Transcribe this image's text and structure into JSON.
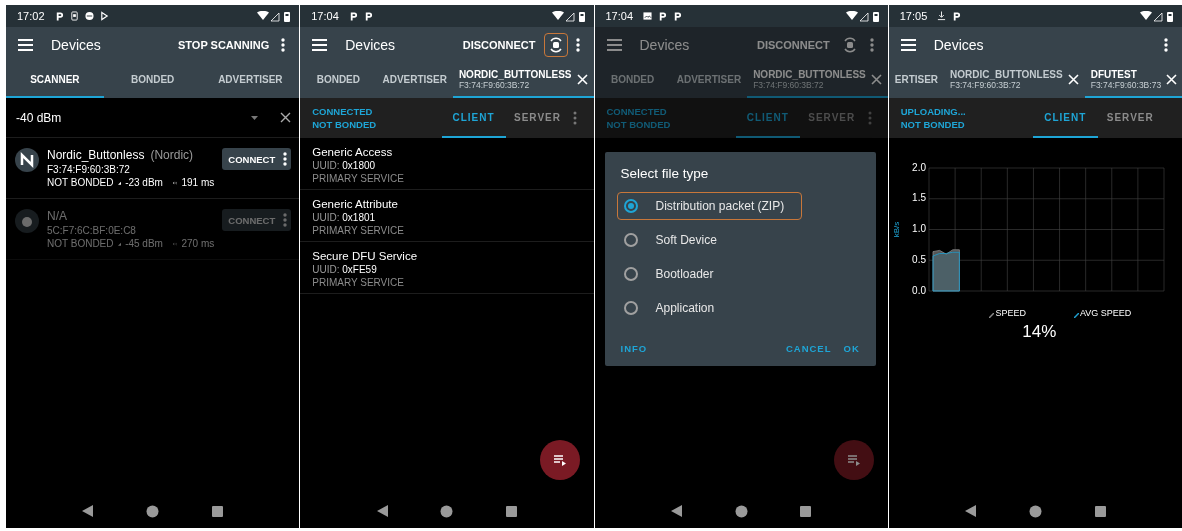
{
  "screens": [
    {
      "kind": "scanner",
      "status_bar": {
        "time": "17:02"
      },
      "app_bar": {
        "title": "Devices",
        "actions": [
          {
            "kind": "text",
            "label": "STOP SCANNING"
          },
          {
            "kind": "menu"
          }
        ]
      },
      "tabs": [
        {
          "label": "SCANNER",
          "selected": true
        },
        {
          "label": "BONDED",
          "selected": false
        },
        {
          "label": "ADVERTISER",
          "selected": false
        }
      ],
      "filter": {
        "value": "-40 dBm"
      },
      "devices": [
        {
          "name": "Nordic_Buttonless",
          "manufacturer": "(Nordic)",
          "address": "F3:74:F9:60:3B:72",
          "bond": "NOT BONDED",
          "rssi": "-23 dBm",
          "interval": "191 ms",
          "button": "CONNECT",
          "dimmed": false
        },
        {
          "name": "N/A",
          "address": "5C:F7:6C:BF:0E:C8",
          "bond": "NOT BONDED",
          "rssi": "-45 dBm",
          "interval": "270 ms",
          "button": "CONNECT",
          "dimmed": true
        }
      ]
    },
    {
      "kind": "services",
      "status_bar": {
        "time": "17:04"
      },
      "app_bar": {
        "title": "Devices",
        "actions": [
          {
            "kind": "text",
            "label": "DISCONNECT"
          },
          {
            "kind": "dfu",
            "highlighted": true
          },
          {
            "kind": "menu"
          }
        ]
      },
      "tabs": [
        {
          "label": "BONDED",
          "selected": false
        },
        {
          "label": "ADVERTISER",
          "selected": false
        },
        {
          "label": "NORDIC_BUTTONLESS",
          "sublabel": "F3:74:F9:60:3B:72",
          "closable": true,
          "selected": true
        }
      ],
      "connection": {
        "lines": [
          "CONNECTED",
          "NOT BONDED"
        ],
        "subtabs": [
          {
            "label": "CLIENT",
            "selected": true
          },
          {
            "label": "SERVER",
            "selected": false
          }
        ],
        "menu": true
      },
      "services": [
        {
          "name": "Generic Access",
          "uuid_label": "UUID:",
          "uuid": "0x1800",
          "type": "PRIMARY SERVICE"
        },
        {
          "name": "Generic Attribute",
          "uuid_label": "UUID:",
          "uuid": "0x1801",
          "type": "PRIMARY SERVICE"
        },
        {
          "name": "Secure DFU Service",
          "uuid_label": "UUID:",
          "uuid": "0xFE59",
          "type": "PRIMARY SERVICE"
        }
      ],
      "fab": true
    },
    {
      "kind": "dialog",
      "status_bar": {
        "time": "17:04"
      },
      "app_bar": {
        "title": "Devices",
        "actions": [
          {
            "kind": "text",
            "label": "DISCONNECT"
          },
          {
            "kind": "dfu",
            "highlighted": false
          },
          {
            "kind": "menu"
          }
        ]
      },
      "tabs": [
        {
          "label": "BONDED",
          "selected": false
        },
        {
          "label": "ADVERTISER",
          "selected": false
        },
        {
          "label": "NORDIC_BUTTONLESS",
          "sublabel": "F3:74:F9:60:3B:72",
          "closable": true,
          "selected": true
        }
      ],
      "connection": {
        "lines": [
          "CONNECTED",
          "NOT BONDED"
        ],
        "subtabs": [
          {
            "label": "CLIENT",
            "selected": true
          },
          {
            "label": "SERVER",
            "selected": false
          }
        ],
        "menu": true
      },
      "fab": true,
      "dialog": {
        "title": "Select file type",
        "options": [
          {
            "label": "Distribution packet (ZIP)",
            "selected": true,
            "highlighted": true
          },
          {
            "label": "Soft Device",
            "selected": false,
            "highlighted": false
          },
          {
            "label": "Bootloader",
            "selected": false,
            "highlighted": false
          },
          {
            "label": "Application",
            "selected": false,
            "highlighted": false
          }
        ],
        "buttons": [
          "INFO",
          "CANCEL",
          "OK"
        ]
      }
    },
    {
      "kind": "upload",
      "status_bar": {
        "time": "17:05"
      },
      "app_bar": {
        "title": "Devices",
        "actions": [
          {
            "kind": "menu"
          }
        ]
      },
      "tabs": [
        {
          "label": "ERTISER",
          "selected": false
        },
        {
          "label": "NORDIC_BUTTONLESS",
          "sublabel": "F3:74:F9:60:3B:72",
          "closable": true,
          "selected": false
        },
        {
          "label": "DFUTEST",
          "sublabel": "F3:74:F9:60:3B:73",
          "closable": true,
          "selected": true
        }
      ],
      "connection": {
        "lines": [
          "UPLOADING...",
          "NOT BONDED"
        ],
        "subtabs": [
          {
            "label": "CLIENT",
            "selected": true
          },
          {
            "label": "SERVER",
            "selected": false
          }
        ],
        "menu": false
      },
      "chart_data": {
        "type": "area",
        "ylabel": "kB/s",
        "grid": true,
        "categories": [
          null,
          null,
          null,
          null,
          null,
          null,
          null,
          null,
          null,
          null,
          null,
          null,
          null,
          null,
          null,
          null,
          null,
          null,
          null,
          null,
          null,
          null,
          null,
          null,
          null,
          null,
          null,
          null,
          null,
          null,
          null,
          null,
          null,
          null,
          null,
          null
        ],
        "ylim": [
          0,
          2
        ],
        "yticks": [
          {
            "value": 0,
            "label": "0.0"
          },
          {
            "value": 0.5,
            "label": "0.5"
          },
          {
            "value": 1,
            "label": "1.0"
          },
          {
            "value": 1.5,
            "label": "1.5"
          },
          {
            "value": 2,
            "label": "2.0"
          }
        ],
        "series": [
          {
            "name": "SPEED",
            "color": "#8a8a8a",
            "values": [
              0.64,
              0.66,
              0.6,
              0.67,
              0.67,
              null,
              null,
              null,
              null,
              null,
              null,
              null,
              null,
              null,
              null,
              null,
              null,
              null,
              null,
              null,
              null,
              null,
              null,
              null,
              null,
              null,
              null,
              null,
              null,
              null,
              null,
              null,
              null,
              null,
              null,
              null
            ]
          },
          {
            "name": "AVG SPEED",
            "color": "#1e9fd0",
            "values": [
              0.57,
              0.61,
              0.61,
              0.63,
              0.63,
              null,
              null,
              null,
              null,
              null,
              null,
              null,
              null,
              null,
              null,
              null,
              null,
              null,
              null,
              null,
              null,
              null,
              null,
              null,
              null,
              null,
              null,
              null,
              null,
              null,
              null,
              null,
              null,
              null,
              null,
              null
            ]
          }
        ]
      },
      "progress": "14%"
    }
  ]
}
